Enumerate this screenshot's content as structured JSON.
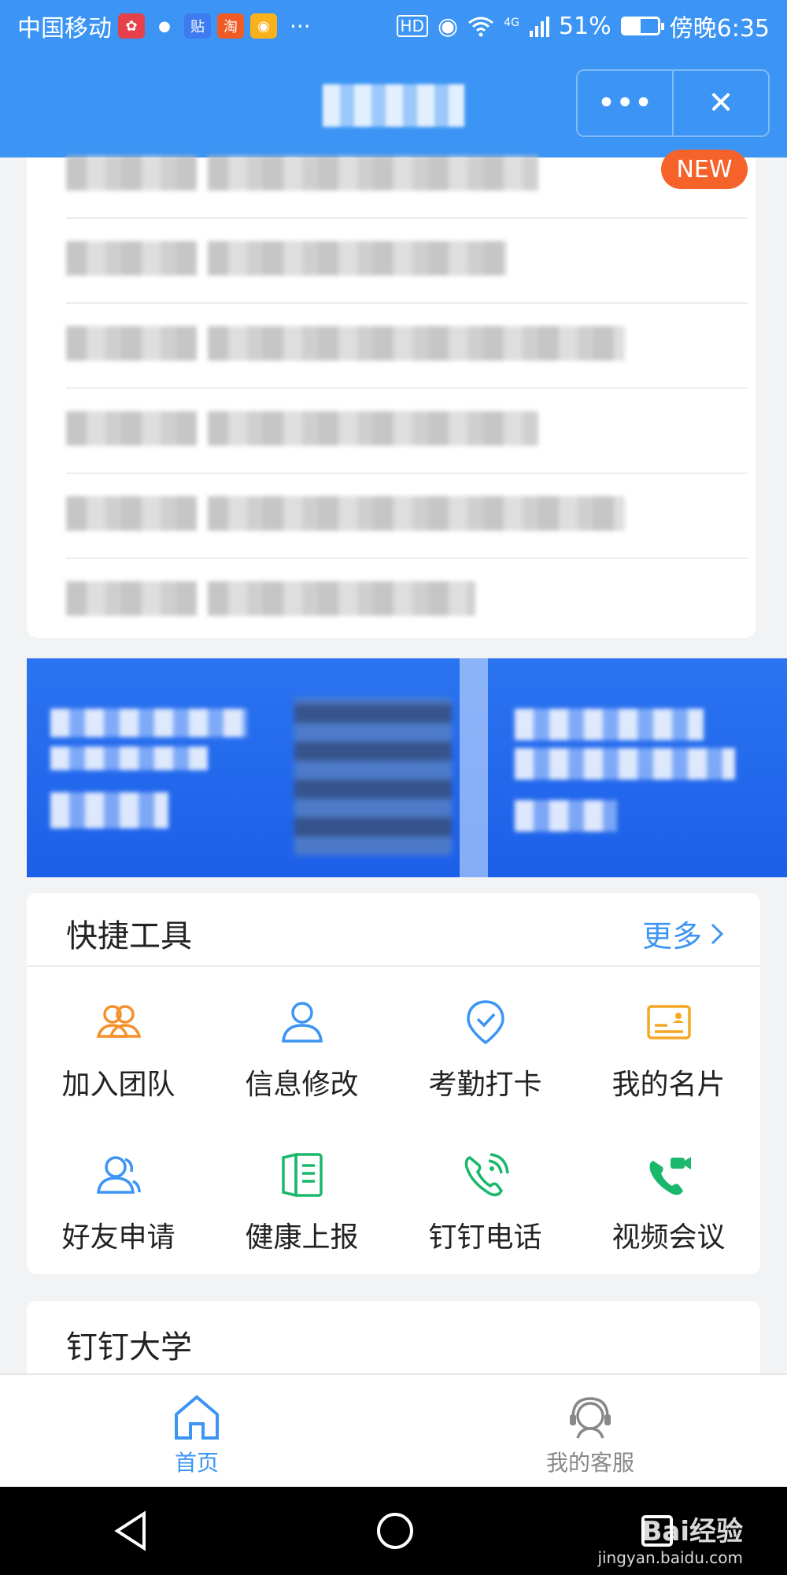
{
  "status_bar": {
    "carrier": "中国移动",
    "battery": "51%",
    "battery_level": 0.51,
    "time": "傍晚6:35",
    "network": "4G",
    "hd": "HD",
    "apps": [
      {
        "icon": "huawei-icon",
        "color": "#e6404a",
        "glyph": "✿"
      },
      {
        "icon": "wechat-icon",
        "color": "#ffffff",
        "glyph": "●"
      },
      {
        "icon": "tieba-icon",
        "color": "#3f7bf0",
        "glyph": "贴"
      },
      {
        "icon": "taobao-icon",
        "color": "#f05a24",
        "glyph": "淘"
      },
      {
        "icon": "weibo-icon",
        "color": "#f9b21c",
        "glyph": "◉"
      }
    ]
  },
  "header": {
    "title": "",
    "more_icon": "more-dots-icon",
    "close_icon": "close-icon"
  },
  "notices": {
    "items": [
      {
        "blurred": true,
        "badge": "NEW"
      },
      {
        "blurred": true,
        "badge": ""
      },
      {
        "blurred": true,
        "badge": ""
      },
      {
        "blurred": true,
        "badge": ""
      },
      {
        "blurred": true,
        "badge": ""
      },
      {
        "blurred": true,
        "badge": ""
      }
    ]
  },
  "quick_tools": {
    "title": "快捷工具",
    "more_label": "更多",
    "items": [
      {
        "label": "加入团队",
        "icon": "join-team-icon",
        "color": "#f5902a"
      },
      {
        "label": "信息修改",
        "icon": "user-edit-icon",
        "color": "#3c95f4"
      },
      {
        "label": "考勤打卡",
        "icon": "checkin-icon",
        "color": "#3c95f4"
      },
      {
        "label": "我的名片",
        "icon": "business-card-icon",
        "color": "#f5a623"
      },
      {
        "label": "好友申请",
        "icon": "friend-request-icon",
        "color": "#3c95f4"
      },
      {
        "label": "健康上报",
        "icon": "health-report-icon",
        "color": "#19b86b"
      },
      {
        "label": "钉钉电话",
        "icon": "ding-call-icon",
        "color": "#19b86b"
      },
      {
        "label": "视频会议",
        "icon": "video-meeting-icon",
        "color": "#19b86b"
      }
    ]
  },
  "university": {
    "title": "钉钉大学"
  },
  "tabbar": {
    "items": [
      {
        "label": "首页",
        "icon": "home-icon",
        "active": true
      },
      {
        "label": "我的客服",
        "icon": "customer-service-icon",
        "active": false
      }
    ]
  },
  "watermark": {
    "brand": "Bai经验",
    "url": "jingyan.baidu.com"
  }
}
